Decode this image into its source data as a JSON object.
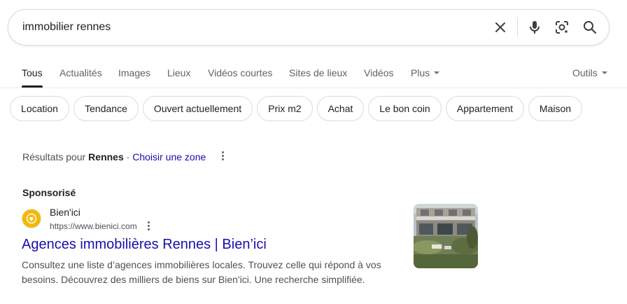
{
  "search": {
    "query": "immobilier rennes",
    "clear_icon": "close-icon",
    "voice_icon": "microphone-icon",
    "lens_icon": "camera-lens-icon",
    "search_icon": "search-icon"
  },
  "tabs": [
    {
      "label": "Tous",
      "active": true
    },
    {
      "label": "Actualités"
    },
    {
      "label": "Images"
    },
    {
      "label": "Lieux"
    },
    {
      "label": "Vidéos courtes"
    },
    {
      "label": "Sites de lieux"
    },
    {
      "label": "Vidéos"
    },
    {
      "label": "Plus"
    }
  ],
  "tools_label": "Outils",
  "chips": [
    "Location",
    "Tendance",
    "Ouvert actuellement",
    "Prix m2",
    "Achat",
    "Le bon coin",
    "Appartement",
    "Maison"
  ],
  "location": {
    "prefix": "Résultats pour",
    "place": "Rennes",
    "separator": "·",
    "link": "Choisir une zone"
  },
  "ad": {
    "label": "Sponsorisé",
    "site_name": "Bien'ici",
    "url": "https://www.bienici.com",
    "title": "Agences immobilières Rennes | Bien’ici",
    "description": "Consultez une liste d’agences immobilières locales. Trouvez celle qui répond à vos besoins. Découvrez des milliers de biens sur Bien'ici. Une recherche simplifiée."
  },
  "colors": {
    "link_blue": "#1a0dab",
    "text": "#202124",
    "muted": "#4d5156",
    "brand_yellow": "#f5b800"
  }
}
